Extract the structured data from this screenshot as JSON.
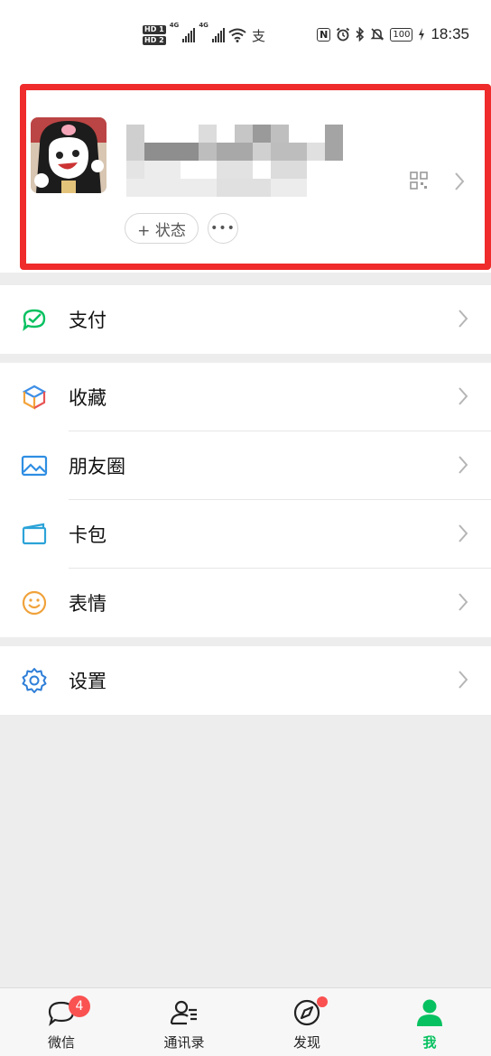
{
  "status_bar": {
    "hd1": "HD 1",
    "hd2": "HD 2",
    "net1": "4G",
    "net2": "4G",
    "alipay_glyph": "支",
    "nfc": "N",
    "battery": "100",
    "time": "18:35"
  },
  "profile": {
    "name_blurred": true,
    "status_chip_label": "+ 状态",
    "more_chip_label": "•••",
    "highlight_color": "#ef2b2b"
  },
  "menu": {
    "group1": [
      {
        "label": "支付",
        "icon": "pay-icon"
      }
    ],
    "group2": [
      {
        "label": "收藏",
        "icon": "favorites-cube-icon"
      },
      {
        "label": "朋友圈",
        "icon": "moments-picture-icon"
      },
      {
        "label": "卡包",
        "icon": "card-wallet-icon"
      },
      {
        "label": "表情",
        "icon": "smiley-icon"
      }
    ],
    "group3": [
      {
        "label": "设置",
        "icon": "settings-gear-icon"
      }
    ]
  },
  "tabbar": {
    "tabs": [
      {
        "label": "微信",
        "icon": "chat-bubble-icon",
        "badge": "4"
      },
      {
        "label": "通讯录",
        "icon": "contacts-icon"
      },
      {
        "label": "发现",
        "icon": "compass-icon",
        "dot": true
      },
      {
        "label": "我",
        "icon": "person-icon",
        "active": true
      }
    ],
    "active_color": "#07c160"
  }
}
